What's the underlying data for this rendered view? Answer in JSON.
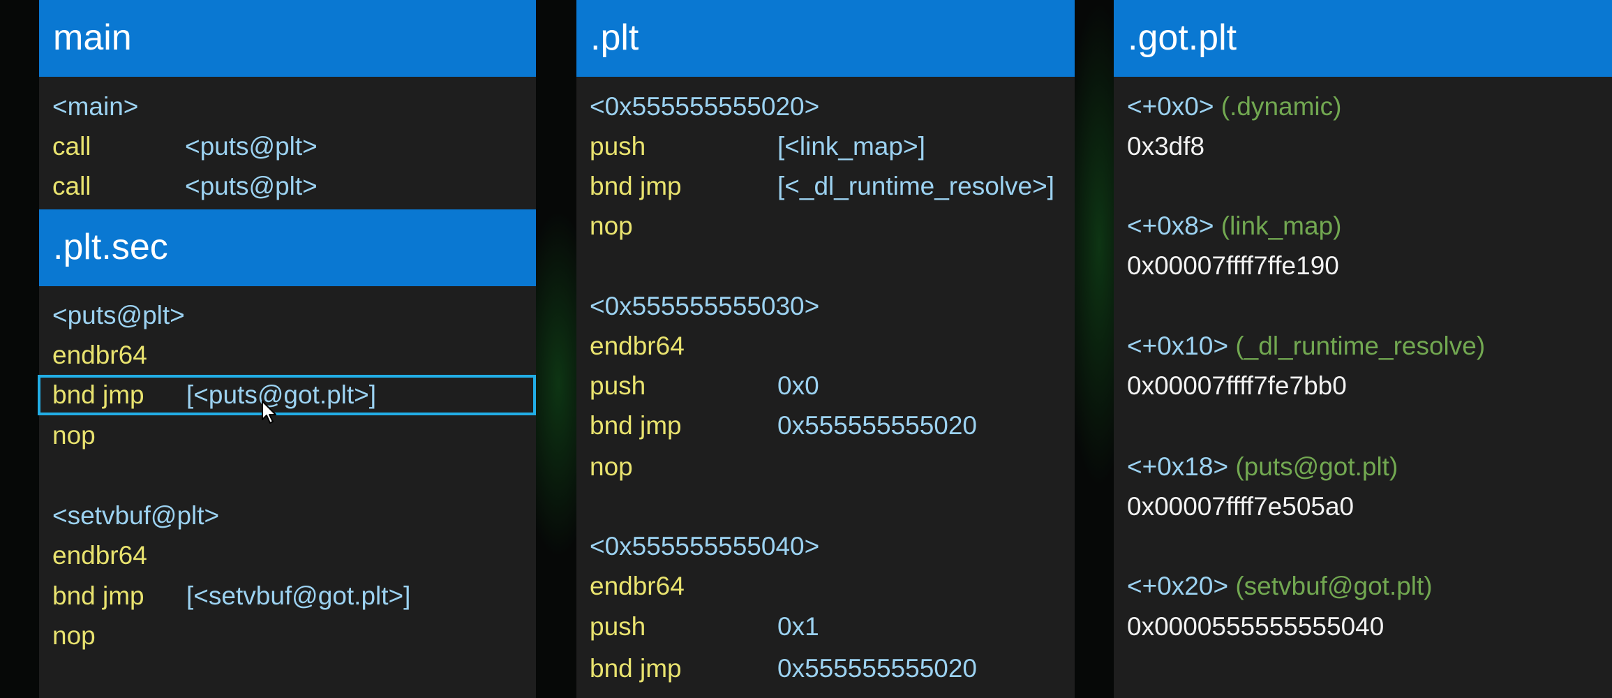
{
  "main": {
    "title": "main",
    "label": "<main>",
    "lines": [
      {
        "mnemonic": "call",
        "operand": "<puts@plt>"
      },
      {
        "mnemonic": "call",
        "operand": "<puts@plt>"
      }
    ]
  },
  "plt_sec": {
    "title": ".plt.sec",
    "puts_label": "<puts@plt>",
    "puts_lines": [
      {
        "mnemonic": "endbr64"
      },
      {
        "mnemonic": "bnd jmp",
        "operand": "[<puts@got.plt>]"
      },
      {
        "mnemonic": "nop"
      }
    ],
    "setvbuf_label": "<setvbuf@plt>",
    "setvbuf_lines": [
      {
        "mnemonic": "endbr64"
      },
      {
        "mnemonic": "bnd jmp",
        "operand": "[<setvbuf@got.plt>]"
      },
      {
        "mnemonic": "nop"
      }
    ]
  },
  "plt": {
    "title": ".plt",
    "blocks": [
      {
        "label": "<0x555555555020>",
        "lines": [
          {
            "mnemonic": "push",
            "operand": "[<link_map>]"
          },
          {
            "mnemonic": "bnd jmp",
            "operand": "[<_dl_runtime_resolve>]"
          },
          {
            "mnemonic": "nop"
          }
        ]
      },
      {
        "label": "<0x555555555030>",
        "lines": [
          {
            "mnemonic": "endbr64"
          },
          {
            "mnemonic": "push",
            "operand": "0x0"
          },
          {
            "mnemonic": "bnd jmp",
            "operand": "0x555555555020"
          },
          {
            "mnemonic": "nop"
          }
        ]
      },
      {
        "label": "<0x555555555040>",
        "lines": [
          {
            "mnemonic": "endbr64"
          },
          {
            "mnemonic": "push",
            "operand": "0x1"
          },
          {
            "mnemonic": "bnd jmp",
            "operand": "0x555555555020"
          }
        ]
      }
    ]
  },
  "got_plt": {
    "title": ".got.plt",
    "entries": [
      {
        "offset": "<+0x0>",
        "name": "(.dynamic)",
        "value": "0x3df8"
      },
      {
        "offset": "<+0x8>",
        "name": "(link_map)",
        "value": "0x00007ffff7ffe190"
      },
      {
        "offset": "<+0x10>",
        "name": "(_dl_runtime_resolve)",
        "value": "0x00007ffff7fe7bb0"
      },
      {
        "offset": "<+0x18>",
        "name": "(puts@got.plt)",
        "value": "0x00007ffff7e505a0"
      },
      {
        "offset": "<+0x20>",
        "name": "(setvbuf@got.plt)",
        "value": "0x0000555555555040"
      }
    ]
  },
  "colors": {
    "header_bg": "#0a78d2",
    "panel_bg": "#1e1e1e",
    "mnemonic": "#e9e36f",
    "label": "#9cd2f1",
    "comment": "#72a851",
    "value": "#f2f2f2",
    "highlight_border": "#22aee6"
  },
  "icons": {
    "cursor": "mouse-pointer-icon"
  }
}
